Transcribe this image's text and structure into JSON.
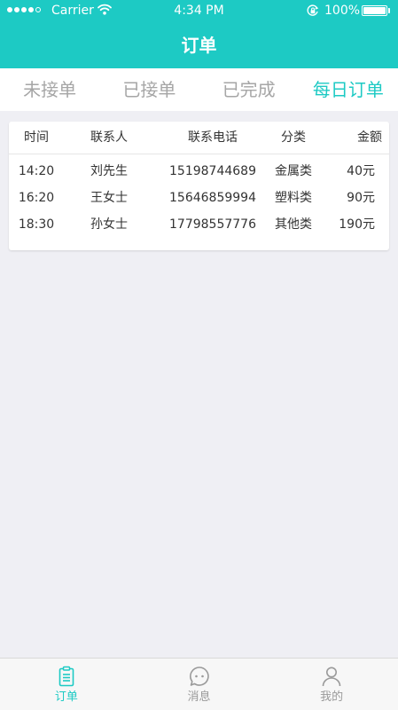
{
  "status_bar": {
    "carrier": "Carrier",
    "time": "4:34 PM",
    "battery": "100%",
    "signal_icon": "signal-dots-icon",
    "wifi_icon": "wifi-icon",
    "lock_icon": "rotation-lock-icon",
    "battery_icon": "battery-icon"
  },
  "nav": {
    "title": "订单"
  },
  "tabs": [
    {
      "label": "未接单",
      "active": false
    },
    {
      "label": "已接单",
      "active": false
    },
    {
      "label": "已完成",
      "active": false
    },
    {
      "label": "每日订单",
      "active": true
    }
  ],
  "orders_table": {
    "headers": {
      "time": "时间",
      "contact": "联系人",
      "phone": "联系电话",
      "category": "分类",
      "amount": "金额"
    },
    "rows": [
      {
        "time": "14:20",
        "contact": "刘先生",
        "phone": "15198744689",
        "category": "金属类",
        "amount": "40元"
      },
      {
        "time": "16:20",
        "contact": "王女士",
        "phone": "15646859994",
        "category": "塑料类",
        "amount": "90元"
      },
      {
        "time": "18:30",
        "contact": "孙女士",
        "phone": "17798557776",
        "category": "其他类",
        "amount": "190元"
      }
    ]
  },
  "tab_bar": {
    "items": [
      {
        "label": "订单",
        "icon": "clipboard-icon",
        "active": true
      },
      {
        "label": "消息",
        "icon": "chat-bubble-icon",
        "active": false
      },
      {
        "label": "我的",
        "icon": "person-icon",
        "active": false
      }
    ]
  },
  "colors": {
    "accent": "#1dcac4",
    "inactive": "#a6a6a6",
    "background": "#efeff4"
  }
}
